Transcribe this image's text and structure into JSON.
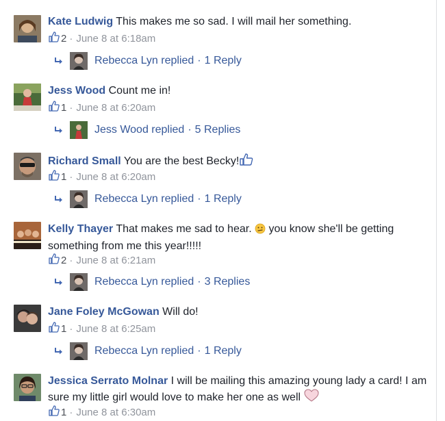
{
  "colors": {
    "link": "#365899",
    "meta": "#90949c",
    "text": "#1d2129",
    "like_icon": "#4267b2"
  },
  "icons": {
    "like": "thumbs-up-icon",
    "reply": "reply-arrow-icon"
  },
  "comments": [
    {
      "author": "Kate Ludwig",
      "text": "This makes me so sad. I will mail her something.",
      "likes": "2",
      "timestamp": "June 8 at 6:18am",
      "reply": {
        "author": "Rebecca Lyn replied",
        "count": "1 Reply"
      }
    },
    {
      "author": "Jess Wood",
      "text": "Count me in!",
      "likes": "1",
      "timestamp": "June 8 at 6:20am",
      "reply": {
        "author": "Jess Wood replied",
        "count": "5 Replies"
      }
    },
    {
      "author": "Richard Small",
      "text": "You are the best Becky!",
      "likes": "1",
      "timestamp": "June 8 at 6:20am",
      "reply": {
        "author": "Rebecca Lyn replied",
        "count": "1 Reply"
      }
    },
    {
      "author": "Kelly Thayer",
      "text": "That makes me sad to hear.",
      "text_after_emoji": "you know she'll be getting something from me this year!!!!!",
      "likes": "2",
      "timestamp": "June 8 at 6:21am",
      "reply": {
        "author": "Rebecca Lyn replied",
        "count": "3 Replies"
      }
    },
    {
      "author": "Jane Foley McGowan",
      "text": "Will do!",
      "likes": "1",
      "timestamp": "June 8 at 6:25am",
      "reply": {
        "author": "Rebecca Lyn replied",
        "count": "1 Reply"
      }
    },
    {
      "author": "Jessica Serrato Molnar",
      "text": "I will be mailing this amazing young lady a card! I am sure my little girl would love to make her one as well",
      "likes": "1",
      "timestamp": "June 8 at 6:30am"
    }
  ]
}
